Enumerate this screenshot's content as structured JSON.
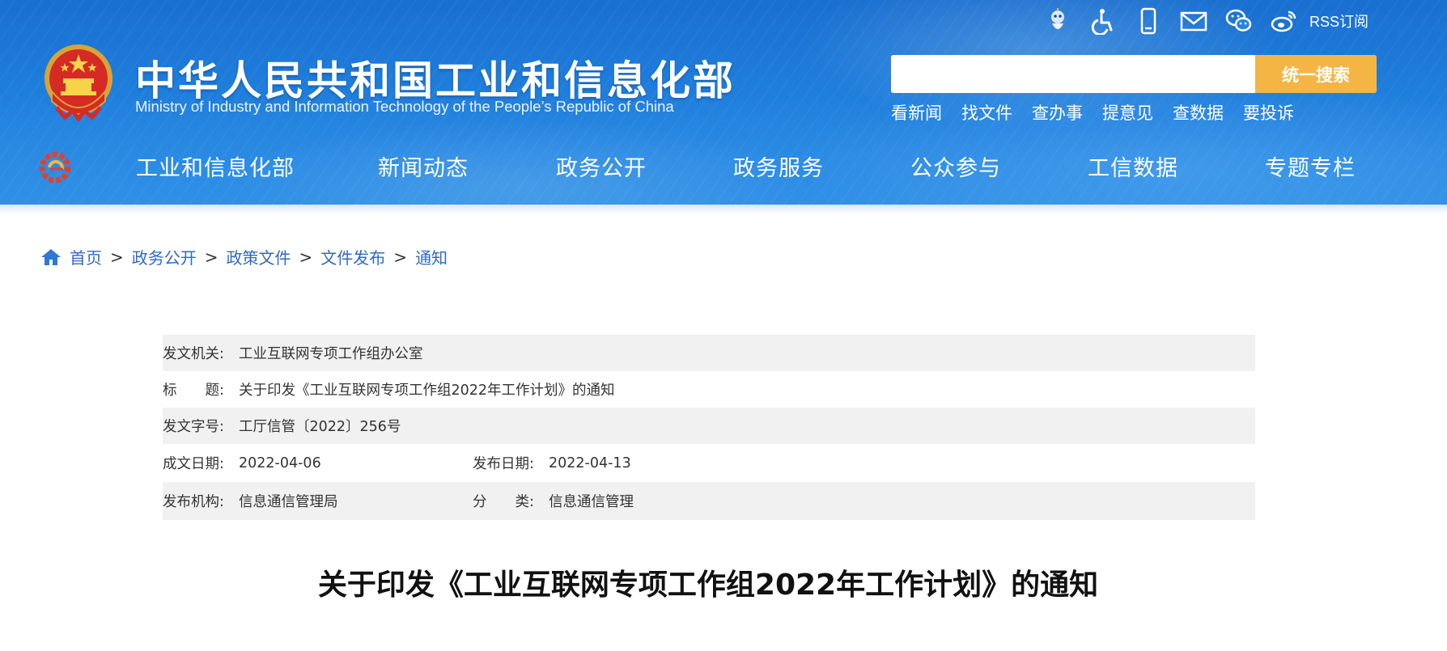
{
  "site": {
    "title_cn": "中华人民共和国工业和信息化部",
    "title_en": "Ministry of Industry and Information Technology of the People’s Republic of China"
  },
  "top_tools": {
    "icons": [
      "robot-icon",
      "accessibility-icon",
      "mobile-icon",
      "mail-icon",
      "wechat-icon",
      "weibo-icon"
    ],
    "rss_label": "RSS订阅"
  },
  "search": {
    "value": "",
    "button_label": "统一搜索"
  },
  "quick_links": [
    "看新闻",
    "找文件",
    "查办事",
    "提意见",
    "查数据",
    "要投诉"
  ],
  "nav": {
    "items": [
      "工业和信息化部",
      "新闻动态",
      "政务公开",
      "政务服务",
      "公众参与",
      "工信数据",
      "专题专栏"
    ]
  },
  "breadcrumb": [
    "首页",
    "政务公开",
    "政策文件",
    "文件发布",
    "通知"
  ],
  "breadcrumb_separator": ">",
  "doc_info": {
    "issuer_label": "发文机关:",
    "issuer": "工业互联网专项工作组办公室",
    "title_label": "标　　题:",
    "title": "关于印发《工业互联网专项工作组2022年工作计划》的通知",
    "number_label": "发文字号:",
    "number": "工厅信管〔2022〕256号",
    "created_label": "成文日期:",
    "created": "2022-04-06",
    "published_label": "发布日期:",
    "published": "2022-04-13",
    "org_label": "发布机构:",
    "org": "信息通信管理局",
    "category_label": "分　　类:",
    "category": "信息通信管理"
  },
  "article": {
    "title": "关于印发《工业互联网专项工作组2022年工作计划》的通知"
  },
  "colors": {
    "header_blue": "#1f7edc",
    "search_button": "#f4b544",
    "breadcrumb_link": "#3169c2",
    "table_shade": "#f1f1f1"
  }
}
